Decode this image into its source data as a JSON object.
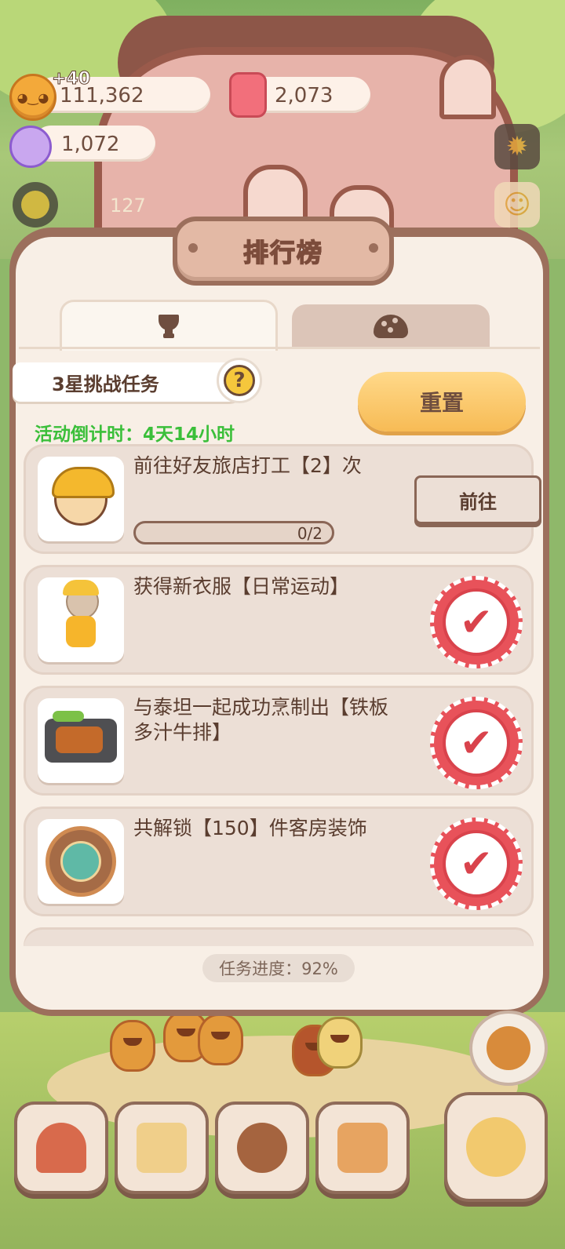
{
  "hud": {
    "cookies": "111,362",
    "cookie_gain": "+40",
    "candles": "2,073",
    "candies": "1,072",
    "level_count": "127",
    "cookie_icon": "cookie-icon",
    "candle_icon": "candle-icon",
    "candy_icon": "candy-icon"
  },
  "panel": {
    "title": "排行榜",
    "tabs": [
      {
        "icon": "trophy-icon",
        "active": true
      },
      {
        "icon": "cookie-icon",
        "active": false
      }
    ],
    "challenge_label": "3星挑战任务",
    "help_glyph": "?",
    "countdown": "活动倒计时：4天14小时",
    "reset_label": "重置",
    "tasks": [
      {
        "text": "前往好友旅店打工【2】次",
        "progress": "0/2",
        "progress_value": 0,
        "action": "前往",
        "done": false
      },
      {
        "text": "获得新衣服【日常运动】",
        "done": true
      },
      {
        "text": "与泰坦一起成功烹制出【铁板多汁牛排】",
        "done": true
      },
      {
        "text": "共解锁【150】件客房装饰",
        "done": true
      }
    ],
    "task_progress": "任务进度：92%"
  },
  "colors": {
    "panel_bg": "#f8efe6",
    "frame": "#9c6f5c",
    "reset_button": "#f7bb55",
    "countdown_green": "#3bbf3a",
    "stamp_red": "#d9434c"
  }
}
